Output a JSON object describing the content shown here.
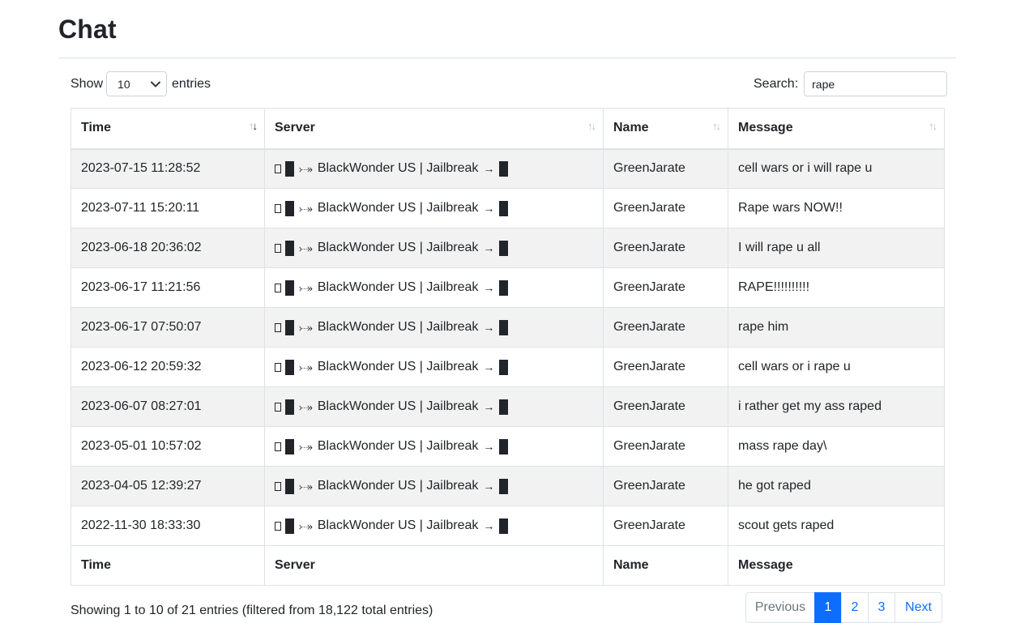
{
  "page": {
    "title": "Chat"
  },
  "length_control": {
    "prefix": "Show",
    "value": "10",
    "suffix": "entries"
  },
  "search": {
    "label": "Search:",
    "value": "rape"
  },
  "table": {
    "columns": [
      "Time",
      "Server",
      "Name",
      "Message"
    ],
    "sort": {
      "column": "Time",
      "direction": "desc"
    },
    "rows": [
      {
        "time": "2023-07-15 11:28:52",
        "server": "BlackWonder US | Jailbreak",
        "name": "GreenJarate",
        "message": "cell wars or i will rape u"
      },
      {
        "time": "2023-07-11 15:20:11",
        "server": "BlackWonder US | Jailbreak",
        "name": "GreenJarate",
        "message": "Rape wars NOW!!"
      },
      {
        "time": "2023-06-18 20:36:02",
        "server": "BlackWonder US | Jailbreak",
        "name": "GreenJarate",
        "message": "I will rape u all"
      },
      {
        "time": "2023-06-17 11:21:56",
        "server": "BlackWonder US | Jailbreak",
        "name": "GreenJarate",
        "message": "RAPE!!!!!!!!!!"
      },
      {
        "time": "2023-06-17 07:50:07",
        "server": "BlackWonder US | Jailbreak",
        "name": "GreenJarate",
        "message": "rape him"
      },
      {
        "time": "2023-06-12 20:59:32",
        "server": "BlackWonder US | Jailbreak",
        "name": "GreenJarate",
        "message": "cell wars or i rape u"
      },
      {
        "time": "2023-06-07 08:27:01",
        "server": "BlackWonder US | Jailbreak",
        "name": "GreenJarate",
        "message": "i rather get my ass raped"
      },
      {
        "time": "2023-05-01 10:57:02",
        "server": "BlackWonder US | Jailbreak",
        "name": "GreenJarate",
        "message": "mass rape day\\"
      },
      {
        "time": "2023-04-05 12:39:27",
        "server": "BlackWonder US | Jailbreak",
        "name": "GreenJarate",
        "message": "he got raped"
      },
      {
        "time": "2022-11-30 18:33:30",
        "server": "BlackWonder US | Jailbreak",
        "name": "GreenJarate",
        "message": "scout gets raped"
      }
    ]
  },
  "info": {
    "text": "Showing 1 to 10 of 21 entries (filtered from 18,122 total entries)"
  },
  "pagination": {
    "previous": "Previous",
    "pages": [
      "1",
      "2",
      "3"
    ],
    "active": "1",
    "next": "Next"
  },
  "colors": {
    "accent": "#0d6efd",
    "stripe": "#f2f2f2",
    "border": "#dee2e6"
  }
}
